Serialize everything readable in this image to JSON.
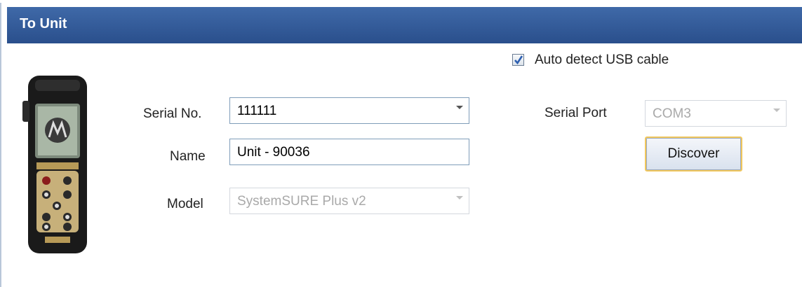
{
  "header": {
    "title": "To Unit"
  },
  "auto_detect": {
    "label": "Auto detect USB cable",
    "checked": true
  },
  "serial_no": {
    "label": "Serial No.",
    "value": "111111"
  },
  "name": {
    "label": "Name",
    "value": "Unit - 90036"
  },
  "model": {
    "label": "Model",
    "value": "SystemSURE Plus v2"
  },
  "serial_port": {
    "label": "Serial Port",
    "value": "COM3"
  },
  "discover": {
    "label": "Discover"
  },
  "device_image": {
    "icon": "handheld-device-image"
  },
  "colors": {
    "header": "#2f5796",
    "button_focus_border": "#f1c75c",
    "field_border": "#7f9db9"
  }
}
